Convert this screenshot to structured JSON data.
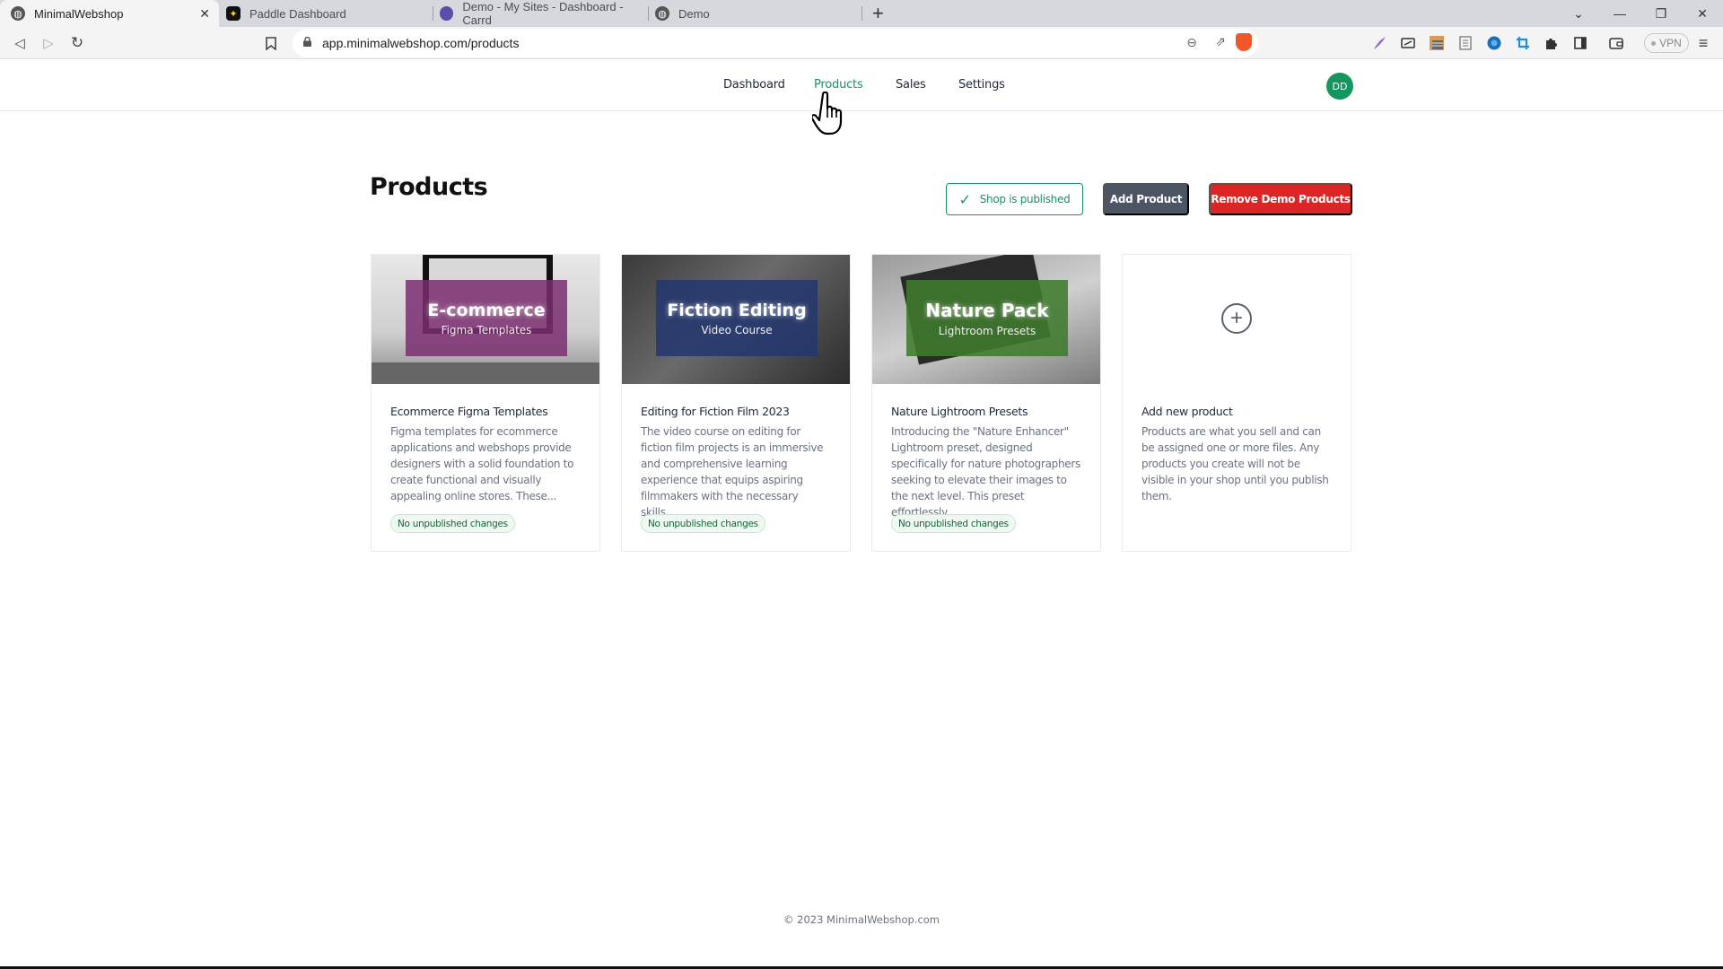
{
  "browser": {
    "tabs": [
      {
        "title": "MinimalWebshop",
        "icon": "globe-icon",
        "active": true
      },
      {
        "title": "Paddle Dashboard",
        "icon": "paddle-icon",
        "active": false
      },
      {
        "title": "Demo - My Sites - Dashboard - Carrd",
        "icon": "carrd-icon",
        "active": false
      },
      {
        "title": "Demo",
        "icon": "globe-icon",
        "active": false
      }
    ],
    "url": "app.minimalwebshop.com/products",
    "vpn_label": "VPN",
    "glyphs": {
      "close": "✕",
      "new_tab": "+",
      "back": "◁",
      "forward": "▷",
      "reload": "↻",
      "minimize": "—",
      "restore": "❐",
      "dropdown": "⌄",
      "menu": "≡",
      "zoom": "⊖",
      "share": "⇗",
      "bookmark": "⛉",
      "globe": "◍",
      "star": "✦"
    }
  },
  "nav": {
    "items": [
      {
        "label": "Dashboard",
        "active": false
      },
      {
        "label": "Products",
        "active": true
      },
      {
        "label": "Sales",
        "active": false
      },
      {
        "label": "Settings",
        "active": false
      }
    ],
    "avatar_initials": "DD"
  },
  "page": {
    "title": "Products",
    "buttons": {
      "published": "Shop is published",
      "published_check": "✓",
      "add": "Add Product",
      "remove_demo": "Remove Demo Products"
    }
  },
  "products": [
    {
      "title": "Ecommerce Figma Templates",
      "description": "Figma templates for ecommerce applications and webshops provide designers with a solid foundation to create functional and visually appealing online stores. These...",
      "badge": "No unpublished changes",
      "banner_title": "E-commerce",
      "banner_subtitle": "Figma Templates",
      "banner_color": "#7a2e6e"
    },
    {
      "title": "Editing for Fiction Film 2023",
      "description": "The video course on editing for fiction film projects is an immersive and comprehensive learning experience that equips aspiring filmmakers with the necessary skills...",
      "badge": "No unpublished changes",
      "banner_title": "Fiction Editing",
      "banner_subtitle": "Video Course",
      "banner_color": "#24386e"
    },
    {
      "title": "Nature Lightroom Presets",
      "description": "Introducing the \"Nature Enhancer\" Lightroom preset, designed specifically for nature photographers seeking to elevate their images to the next level. This preset effortlessly...",
      "badge": "No unpublished changes",
      "banner_title": "Nature Pack",
      "banner_subtitle": "Lightroom Presets",
      "banner_color": "#3f7a2e"
    }
  ],
  "add_card": {
    "title": "Add new product",
    "description": "Products are what you sell and can be assigned one or more files. Any products you create will not be visible in your shop until you publish them.",
    "plus": "+"
  },
  "footer": "© 2023 MinimalWebshop.com",
  "colors": {
    "accent_green": "#15936a",
    "avatar_green": "#16965f",
    "danger_red": "#dc2626",
    "slate_button": "#4b5563"
  }
}
